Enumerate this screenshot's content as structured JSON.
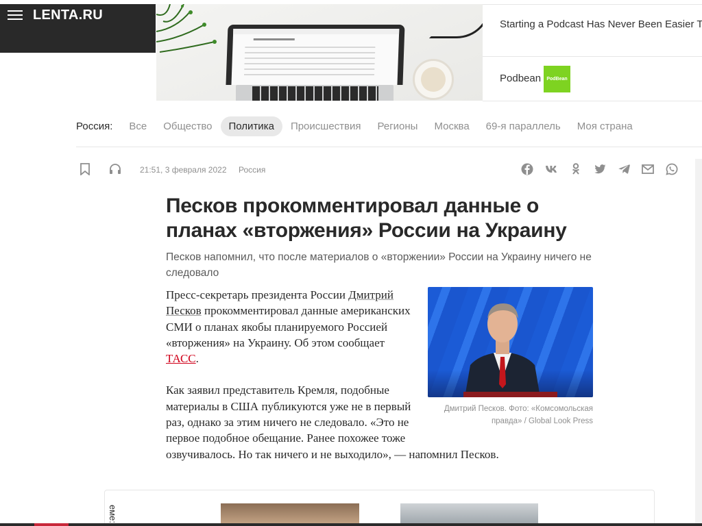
{
  "header": {
    "logo_text": "LENTA.RU"
  },
  "ad": {
    "title": "Starting a Podcast Has Never Been Easier Today.",
    "brand": "Podbean",
    "brand_logo_text": "PodBean"
  },
  "nav": {
    "section_label": "Россия:",
    "items": [
      {
        "label": "Все",
        "active": false
      },
      {
        "label": "Общество",
        "active": false
      },
      {
        "label": "Политика",
        "active": true
      },
      {
        "label": "Происшествия",
        "active": false
      },
      {
        "label": "Регионы",
        "active": false
      },
      {
        "label": "Москва",
        "active": false
      },
      {
        "label": "69-я параллель",
        "active": false
      },
      {
        "label": "Моя страна",
        "active": false
      }
    ]
  },
  "meta": {
    "date": "21:51, 3 февраля 2022",
    "rubric": "Россия"
  },
  "article": {
    "headline": "Песков прокомментировал данные о планах «вторжения» России на Украину",
    "lead": "Песков напомнил, что после материалов о «вторжении» России на Украину ничего не следовало",
    "p1_before": "Пресс-секретарь президента России ",
    "p1_link": "Дмитрий Песков",
    "p1_middle": " прокомментировал данные американских СМИ о планах якобы планируемого Россией «вторжения» на Украину. Об этом сообщает ",
    "p1_source": "ТАСС",
    "p1_end": ".",
    "p2": "Как заявил представитель Кремля, подобные материалы в США публикуются уже не в первый раз, однако за этим ничего не следовало. «Это не первое подобное обещание. Ранее похожее тоже озвучивалось. Но так ничего и не выходило», — напомнил Песков.",
    "photo_caption": "Дмитрий Песков. Фото: «Комсомольская правда» / Global Look Press"
  },
  "related": {
    "label": "еме:"
  },
  "colors": {
    "header_bg": "#292929",
    "accent_red": "#d0021b",
    "podbean_green": "#7ed321",
    "nav_active_bg": "#e8e8e8"
  },
  "icons": {
    "meta": [
      "bookmark-icon",
      "headphones-icon"
    ],
    "share": [
      "facebook-icon",
      "vk-icon",
      "odnoklassniki-icon",
      "twitter-icon",
      "telegram-icon",
      "mail-icon",
      "whatsapp-icon"
    ]
  }
}
